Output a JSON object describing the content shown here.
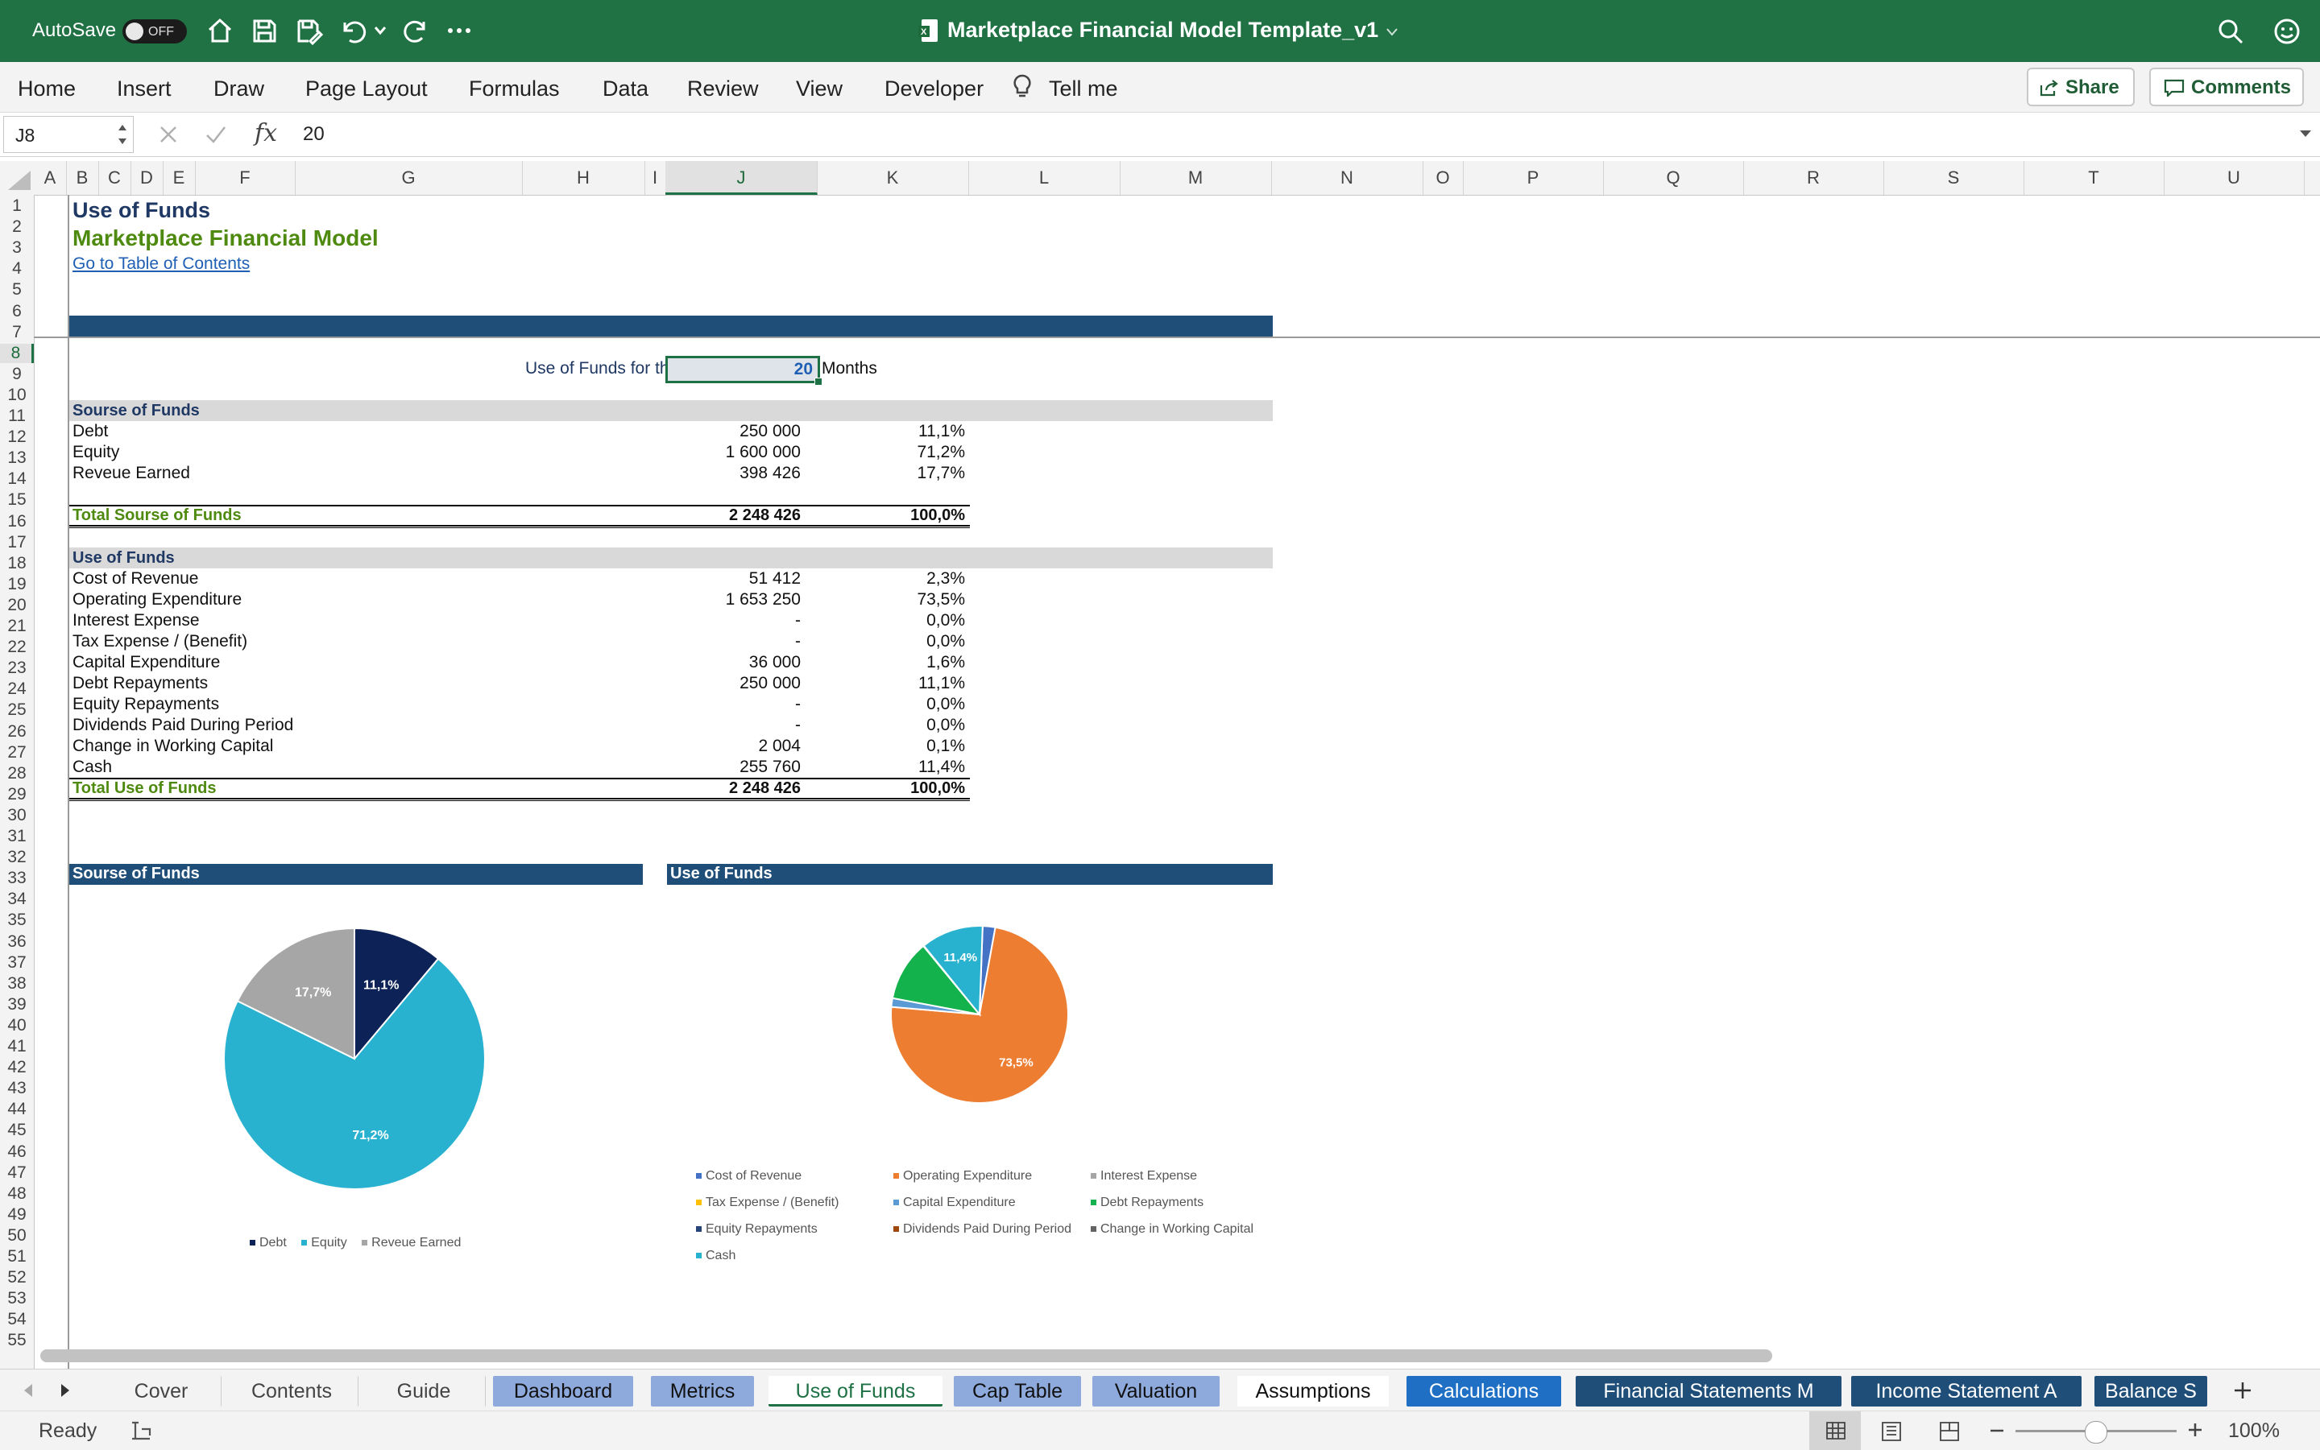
{
  "titlebar": {
    "autosave_label": "AutoSave",
    "autosave_state": "OFF",
    "doc_title": "Marketplace Financial Model Template_v1"
  },
  "ribbon": {
    "tabs": [
      "Home",
      "Insert",
      "Draw",
      "Page Layout",
      "Formulas",
      "Data",
      "Review",
      "View",
      "Developer",
      "Tell me"
    ],
    "share": "Share",
    "comments": "Comments"
  },
  "formula_bar": {
    "cell_ref": "J8",
    "fx": "fx",
    "value": "20"
  },
  "columns": [
    "A",
    "B",
    "C",
    "D",
    "E",
    "F",
    "G",
    "H",
    "I",
    "J",
    "K",
    "L",
    "M",
    "N",
    "O",
    "P",
    "Q",
    "R",
    "S",
    "T",
    "U"
  ],
  "rows": [
    "1",
    "2",
    "3",
    "4",
    "5",
    "6",
    "7",
    "8",
    "9",
    "10",
    "11",
    "12",
    "13",
    "14",
    "15",
    "16",
    "17",
    "18",
    "19",
    "20",
    "21",
    "22",
    "23",
    "24",
    "25",
    "26",
    "27",
    "28",
    "29",
    "30",
    "31",
    "32",
    "33",
    "34",
    "35",
    "36",
    "37",
    "38",
    "39",
    "40",
    "41",
    "42",
    "43",
    "44",
    "45",
    "46",
    "47",
    "48",
    "49",
    "50",
    "51",
    "52",
    "53",
    "54",
    "55"
  ],
  "sheet": {
    "title": "Use of Funds",
    "subtitle": "Marketplace Financial Model",
    "toc_link": "Go to Table of Contents",
    "period_label": "Use of Funds for th",
    "period_value": "20",
    "period_unit": "Months",
    "source": {
      "header": "Sourse of Funds",
      "items": [
        {
          "label": "Debt",
          "amount": "250 000",
          "pct": "11,1%"
        },
        {
          "label": "Equity",
          "amount": "1 600 000",
          "pct": "71,2%"
        },
        {
          "label": "Reveue Earned",
          "amount": "398 426",
          "pct": "17,7%"
        }
      ],
      "total_label": "Total Sourse of Funds",
      "total_amount": "2 248 426",
      "total_pct": "100,0%"
    },
    "use": {
      "header": "Use of Funds",
      "items": [
        {
          "label": "Cost of Revenue",
          "amount": "51 412",
          "pct": "2,3%"
        },
        {
          "label": "Operating Expenditure",
          "amount": "1 653 250",
          "pct": "73,5%"
        },
        {
          "label": "Interest Expense",
          "amount": "-",
          "pct": "0,0%"
        },
        {
          "label": "Tax Expense / (Benefit)",
          "amount": "-",
          "pct": "0,0%"
        },
        {
          "label": "Capital Expenditure",
          "amount": "36 000",
          "pct": "1,6%"
        },
        {
          "label": "Debt Repayments",
          "amount": "250 000",
          "pct": "11,1%"
        },
        {
          "label": "Equity Repayments",
          "amount": "-",
          "pct": "0,0%"
        },
        {
          "label": "Dividends Paid During Period",
          "amount": "-",
          "pct": "0,0%"
        },
        {
          "label": "Change in Working Capital",
          "amount": "2 004",
          "pct": "0,1%"
        },
        {
          "label": "Cash",
          "amount": "255 760",
          "pct": "11,4%"
        }
      ],
      "total_label": "Total Use of Funds",
      "total_amount": "2 248 426",
      "total_pct": "100,0%"
    }
  },
  "chart_data": [
    {
      "type": "pie",
      "title": "Sourse of Funds",
      "categories": [
        "Debt",
        "Equity",
        "Reveue Earned"
      ],
      "values": [
        11.1,
        71.2,
        17.7
      ],
      "data_labels": [
        "11,1%",
        "71,2%",
        "17,7%"
      ],
      "colors": [
        "#0d2257",
        "#29b2cf",
        "#a6a6a6"
      ],
      "legend": "bottom"
    },
    {
      "type": "pie",
      "title": "Use of Funds",
      "categories": [
        "Cost of Revenue",
        "Operating Expenditure",
        "Interest Expense",
        "Tax Expense / (Benefit)",
        "Capital Expenditure",
        "Debt Repayments",
        "Equity Repayments",
        "Dividends Paid During Period",
        "Change in Working Capital",
        "Cash"
      ],
      "values": [
        2.3,
        73.5,
        0.0,
        0.0,
        1.6,
        11.1,
        0.0,
        0.0,
        0.1,
        11.4
      ],
      "data_labels": [
        "",
        "73,5%",
        "",
        "",
        "",
        "",
        "",
        "",
        "",
        "11,4%"
      ],
      "colors": [
        "#4472c4",
        "#ed7d31",
        "#a5a5a5",
        "#ffc000",
        "#5b9bd5",
        "#13b24c",
        "#264478",
        "#9e480e",
        "#636363",
        "#29b2cf"
      ],
      "legend": "bottom"
    }
  ],
  "sheet_tabs": {
    "tabs": [
      "Cover",
      "Contents",
      "Guide",
      "Dashboard",
      "Metrics",
      "Use of Funds",
      "Cap Table",
      "Valuation",
      "Assumptions",
      "Calculations",
      "Financial Statements M",
      "Income Statement A",
      "Balance S"
    ],
    "active": "Use of Funds"
  },
  "status": {
    "ready": "Ready",
    "zoom": "100%"
  }
}
